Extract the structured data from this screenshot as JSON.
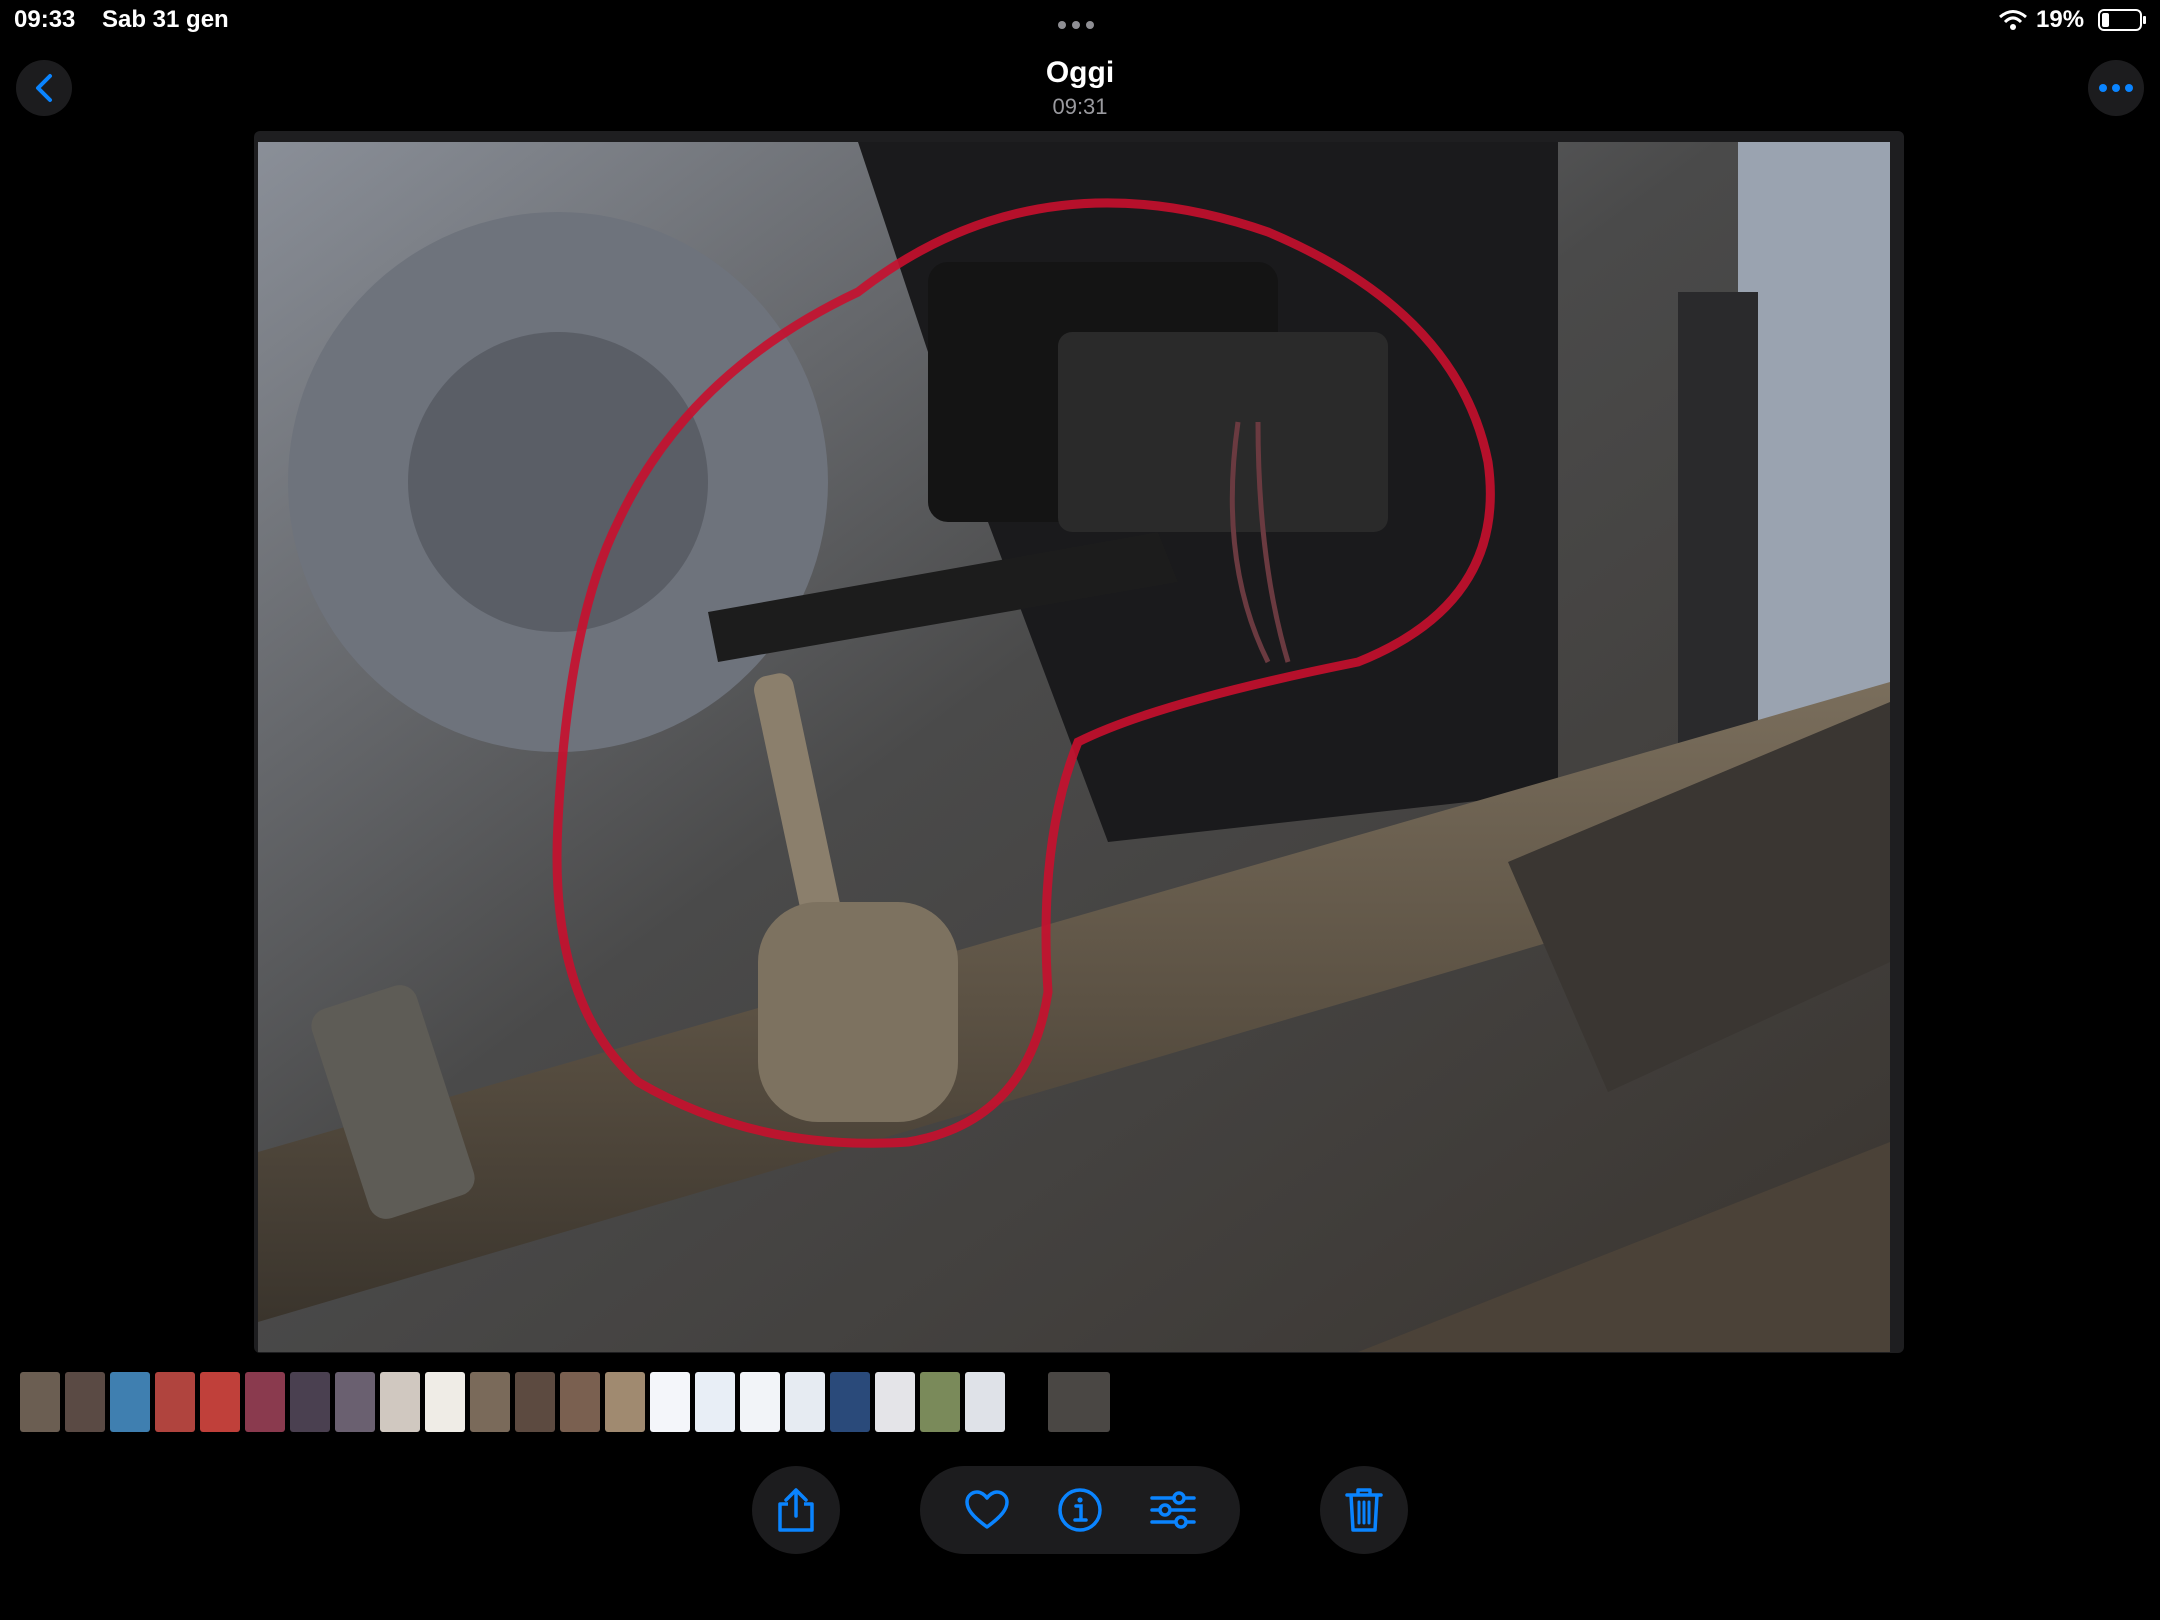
{
  "status_bar": {
    "time": "09:33",
    "date": "Sab 31 gen",
    "battery": "19%"
  },
  "header": {
    "title": "Oggi",
    "subtitle": "09:31"
  },
  "photo": {
    "description_icon": "photo-image"
  },
  "thumbnails": {
    "count": 24,
    "selected_index": 23
  },
  "toolbar": {
    "share": "share-icon",
    "favorite": "heart-icon",
    "info": "info-icon",
    "adjust": "sliders-icon",
    "delete": "trash-icon"
  },
  "colors": {
    "accent": "#0a84ff",
    "background": "#000000",
    "button_bg": "#1c1c1e",
    "annotation": "#c8102e"
  }
}
